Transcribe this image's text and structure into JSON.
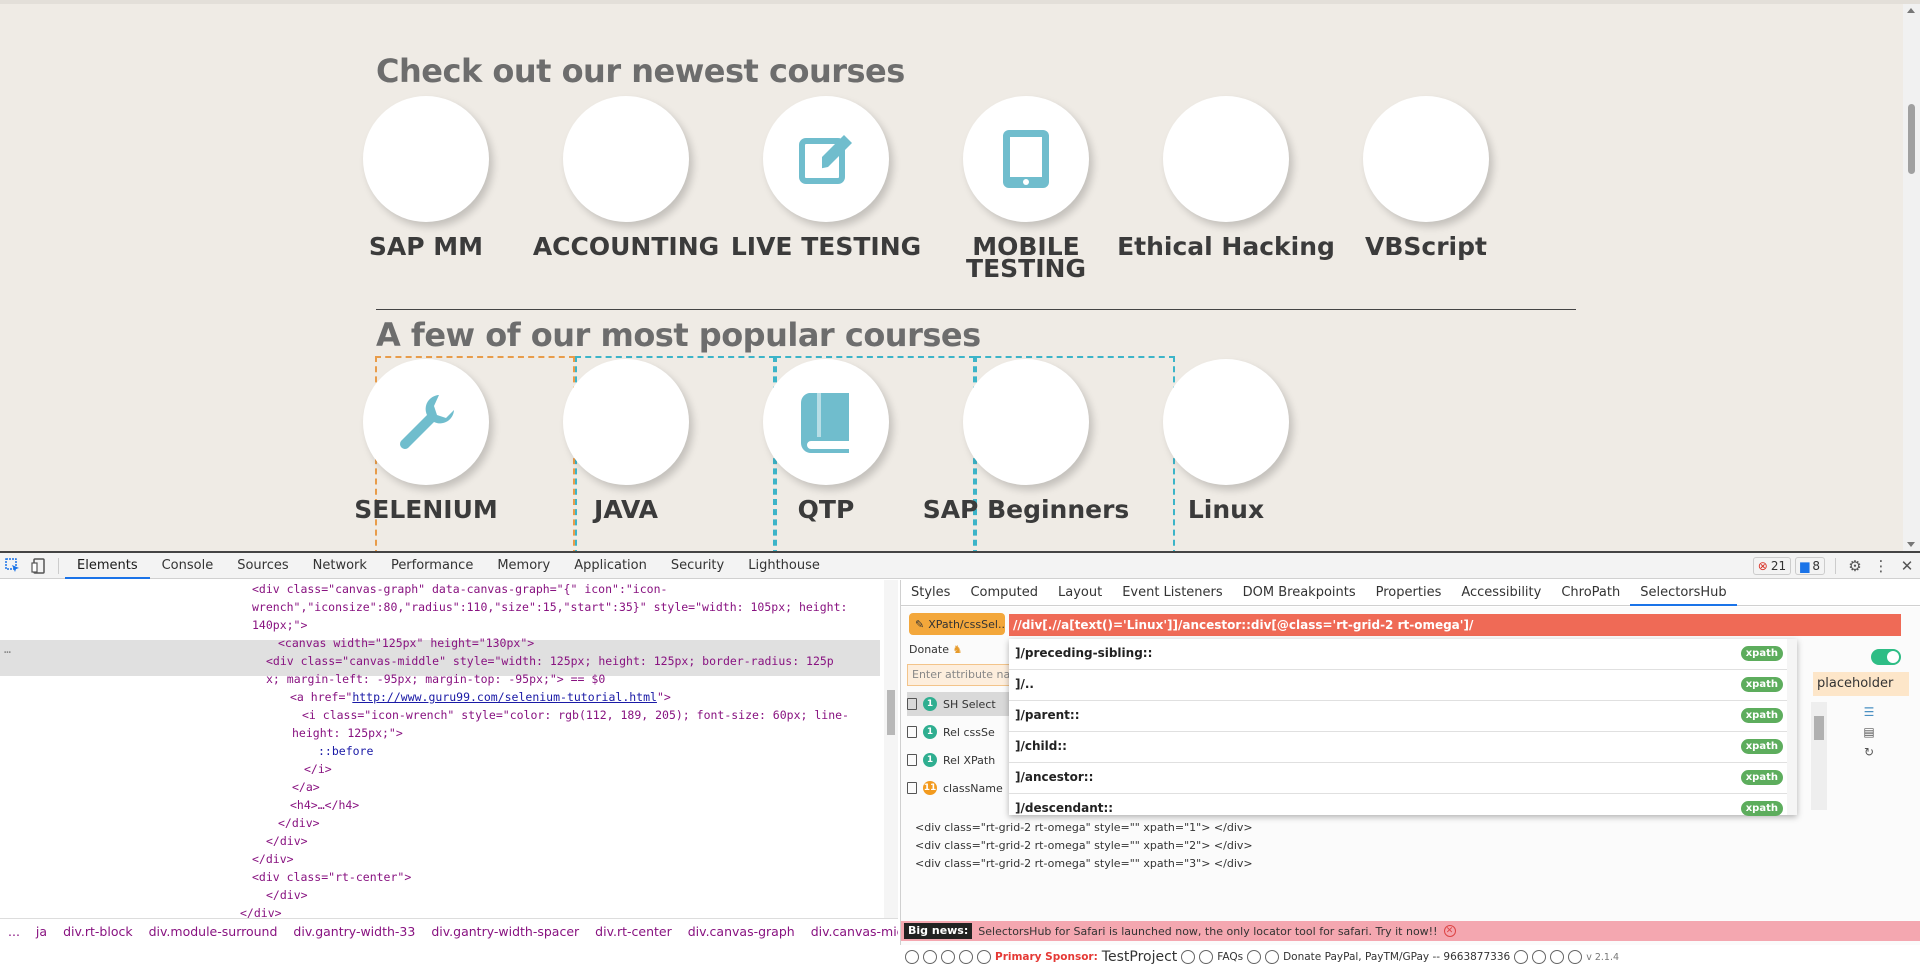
{
  "page": {
    "newest_title": "Check out our newest courses",
    "popular_title": "A few of our most popular courses",
    "newest_courses": [
      {
        "label": "SAP MM",
        "icon": "none"
      },
      {
        "label": "ACCOUNTING",
        "icon": "none"
      },
      {
        "label": "LIVE TESTING",
        "icon": "edit-icon"
      },
      {
        "label": "MOBILE TESTING",
        "icon": "tablet-icon"
      },
      {
        "label": "Ethical Hacking",
        "icon": "none"
      },
      {
        "label": "VBScript",
        "icon": "none"
      }
    ],
    "popular_courses": [
      {
        "label": "SELENIUM",
        "icon": "wrench-icon"
      },
      {
        "label": "JAVA",
        "icon": "none"
      },
      {
        "label": "QTP",
        "icon": "book-icon"
      },
      {
        "label": "SAP Beginners",
        "icon": "none"
      },
      {
        "label": "Linux",
        "icon": "none"
      }
    ],
    "icon_color": "#70bdcd"
  },
  "devtools": {
    "tabs": [
      "Elements",
      "Console",
      "Sources",
      "Network",
      "Performance",
      "Memory",
      "Application",
      "Security",
      "Lighthouse"
    ],
    "active_tab": "Elements",
    "error_count": "21",
    "message_count": "8",
    "code": {
      "l1a": "<div class=\"canvas-graph\" data-canvas-graph=\"{\" icon\":\"icon-",
      "l1b": "wrench\",\"iconsize\":80,\"radius\":110,\"size\":15,\"start\":35}\" style=\"width: 105px; height:",
      "l1c": "140px;\">",
      "l2": "<canvas width=\"125px\" height=\"130px\">",
      "l3a": "<div class=\"canvas-middle\" style=\"width: 125px; height: 125px; border-radius: 125p",
      "l3b": "x; margin-left: -95px; margin-top: -95px;\"> == $0",
      "l4_pre": "<a href=\"",
      "l4_link": "http://www.guru99.com/selenium-tutorial.html",
      "l4_post": "\">",
      "l5a": "<i class=\"icon-wrench\" style=\"color: rgb(112, 189, 205); font-size: 60px; line-",
      "l5b": "height: 125px;\">",
      "l6": "::before",
      "l7": "</i>",
      "l8": "</a>",
      "l9": "<h4>…</h4>",
      "l10": "</div>",
      "l11": "</div>",
      "l12": "</div>",
      "l13": "<div class=\"rt-center\">",
      "l14": "</div>",
      "l15": "</div>"
    },
    "breadcrumbs": [
      "...",
      "ja",
      "div.rt-block",
      "div.module-surround",
      "div.gantry-width-33",
      "div.gantry-width-spacer",
      "div.rt-center",
      "div.canvas-graph",
      "div.canvas-middle"
    ],
    "side_tabs": [
      "Styles",
      "Computed",
      "Layout",
      "Event Listeners",
      "DOM Breakpoints",
      "Properties",
      "Accessibility",
      "ChroPath",
      "SelectorsHub"
    ],
    "side_active": "SelectorsHub",
    "selectorshub": {
      "xpath_button": "XPath/cssSel..",
      "xpath_value": "//div[.//a[text()='Linux']]/ancestor::div[@class='rt-grid-2 rt-omega']/",
      "donate": "Donate",
      "attr_placeholder": "Enter attribute nam",
      "rows": [
        {
          "count": "1",
          "label": "SH Select"
        },
        {
          "count": "1",
          "label": "Rel cssSe"
        },
        {
          "count": "1",
          "label": "Rel XPath"
        },
        {
          "count": "11",
          "label": "className"
        }
      ],
      "suggestions": [
        "]/preceding-sibling::",
        "]/..",
        "]/parent::",
        "]/child::",
        "]/ancestor::",
        "]/descendant::"
      ],
      "suggestion_badge": "xpath",
      "placeholder_chip": "placeholder",
      "results": [
        "<div class=\"rt-grid-2 rt-omega\" style=\"\" xpath=\"1\"> </div>",
        "<div class=\"rt-grid-2 rt-omega\" style=\"\" xpath=\"2\"> </div>",
        "<div class=\"rt-grid-2 rt-omega\" style=\"\" xpath=\"3\"> </div>"
      ],
      "big_news_label": "Big news:",
      "big_news_text": "SelectorsHub for Safari is launched now, the only locator tool for safari. Try it now!!",
      "primary_sponsor": "Primary Sponsor:",
      "sponsor_name": "TestProject",
      "faqs": "FAQs",
      "donate_text": "Donate PayPal, PayTM/GPay -- 9663877336",
      "version": "v 2.1.4"
    }
  }
}
